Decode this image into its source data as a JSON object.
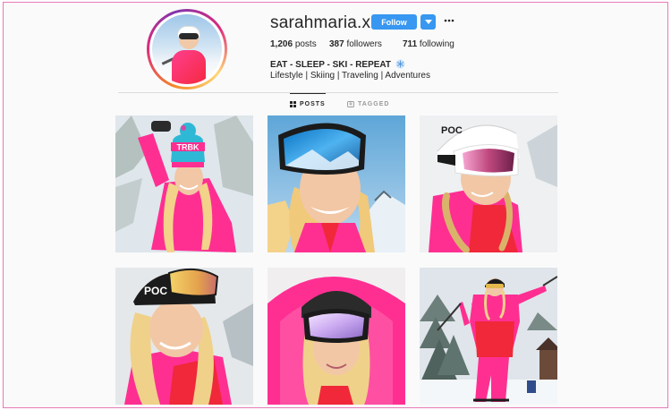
{
  "profile": {
    "username": "sarahmaria.x3na",
    "follow_label": "Follow",
    "stats": [
      {
        "count": "1,206",
        "label": "posts"
      },
      {
        "count": "387",
        "label": "followers"
      },
      {
        "count": "711",
        "label": "following"
      }
    ],
    "full_name": "EAT - SLEEP - SKI - REPEAT",
    "bio": "Lifestyle | Skiing | Traveling | Adventures"
  },
  "tabs": [
    {
      "label": "POSTS",
      "icon": "grid-icon",
      "active": true
    },
    {
      "label": "TAGGED",
      "icon": "tag-icon",
      "active": false
    }
  ],
  "colors": {
    "follow_blue": "#3897f0",
    "frame_pink": "#e87bb8",
    "jacket_pink": "#ff2f92",
    "jacket_red": "#f0283a"
  },
  "posts": [
    {
      "hat_text": "TRBK"
    },
    {},
    {
      "helmet_text": "POC"
    },
    {
      "helmet_text": "POC"
    },
    {},
    {}
  ]
}
